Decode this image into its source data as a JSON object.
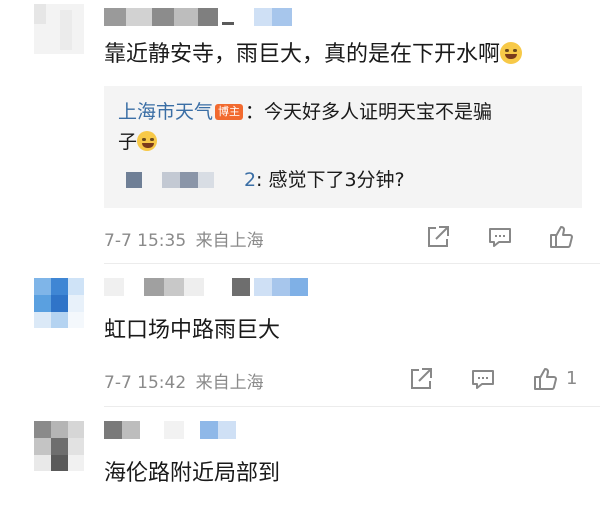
{
  "comments": [
    {
      "text": "靠近静安寺，雨巨大，真的是在下开水啊",
      "emoji_icon": "laughing-tears-emoji",
      "reply_box": {
        "reply1_user": "上海市天气",
        "reply1_badge": "博主",
        "reply1_text_line1": "：今天好多人证明天宝不是骗",
        "reply1_text_line2": "子",
        "reply1_emoji_icon": "scared-face-emoji",
        "reply2_prefix": "2",
        "reply2_text": ": 感觉下了3分钟?"
      },
      "time": "7-7 15:35",
      "location": "来自上海",
      "likes": ""
    },
    {
      "text": "虹口场中路雨巨大",
      "time": "7-7 15:42",
      "location": "来自上海",
      "likes": "1"
    },
    {
      "text": "海伦路附近局部到"
    }
  ],
  "icons": {
    "share": "share-icon",
    "comment": "comment-icon",
    "like": "thumbs-up-icon"
  },
  "colors": {
    "link_blue": "#3a6ea5",
    "badge_orange": "#f26a2f",
    "meta_gray": "#8a8a8a"
  }
}
